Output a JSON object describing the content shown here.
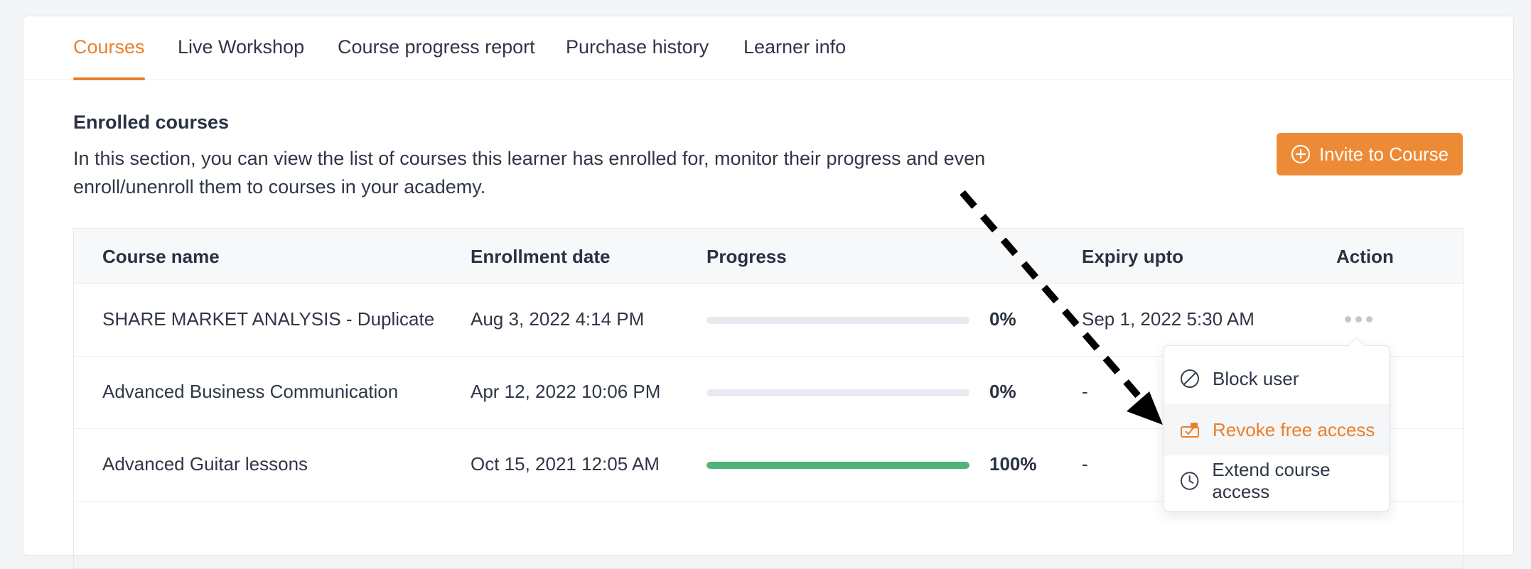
{
  "tabs": [
    {
      "label": "Courses",
      "active": true
    },
    {
      "label": "Live Workshop",
      "active": false
    },
    {
      "label": "Course progress report",
      "active": false
    },
    {
      "label": "Purchase history",
      "active": false
    },
    {
      "label": "Learner info",
      "active": false
    }
  ],
  "section": {
    "title": "Enrolled courses",
    "description": "In this section, you can view the list of courses this learner has enrolled for, monitor their progress and even enroll/unenroll them to courses in your academy."
  },
  "invite_button": {
    "label": "Invite to Course",
    "icon": "plus-circle-icon"
  },
  "table": {
    "headers": {
      "course_name": "Course name",
      "enrollment_date": "Enrollment date",
      "progress": "Progress",
      "expiry": "Expiry upto",
      "action": "Action"
    },
    "rows": [
      {
        "course_name": "SHARE MARKET ANALYSIS - Duplicate",
        "enrollment_date": "Aug 3, 2022 4:14 PM",
        "progress": 0,
        "progress_label": "0%",
        "expiry": "Sep 1, 2022 5:30 AM"
      },
      {
        "course_name": "Advanced Business Communication",
        "enrollment_date": "Apr 12, 2022 10:06 PM",
        "progress": 0,
        "progress_label": "0%",
        "expiry": "-"
      },
      {
        "course_name": "Advanced Guitar lessons",
        "enrollment_date": "Oct 15, 2021 12:05 AM",
        "progress": 100,
        "progress_label": "100%",
        "expiry": "-"
      }
    ]
  },
  "action_menu": {
    "items": [
      {
        "label": "Block user",
        "icon": "block-icon"
      },
      {
        "label": "Revoke free access",
        "icon": "revoke-access-icon"
      },
      {
        "label": "Extend course access",
        "icon": "clock-icon"
      }
    ]
  },
  "colors": {
    "accent": "#e9802c",
    "button": "#ec8a35",
    "progress_complete": "#4fb37a",
    "progress_track": "#e7eaf0"
  }
}
